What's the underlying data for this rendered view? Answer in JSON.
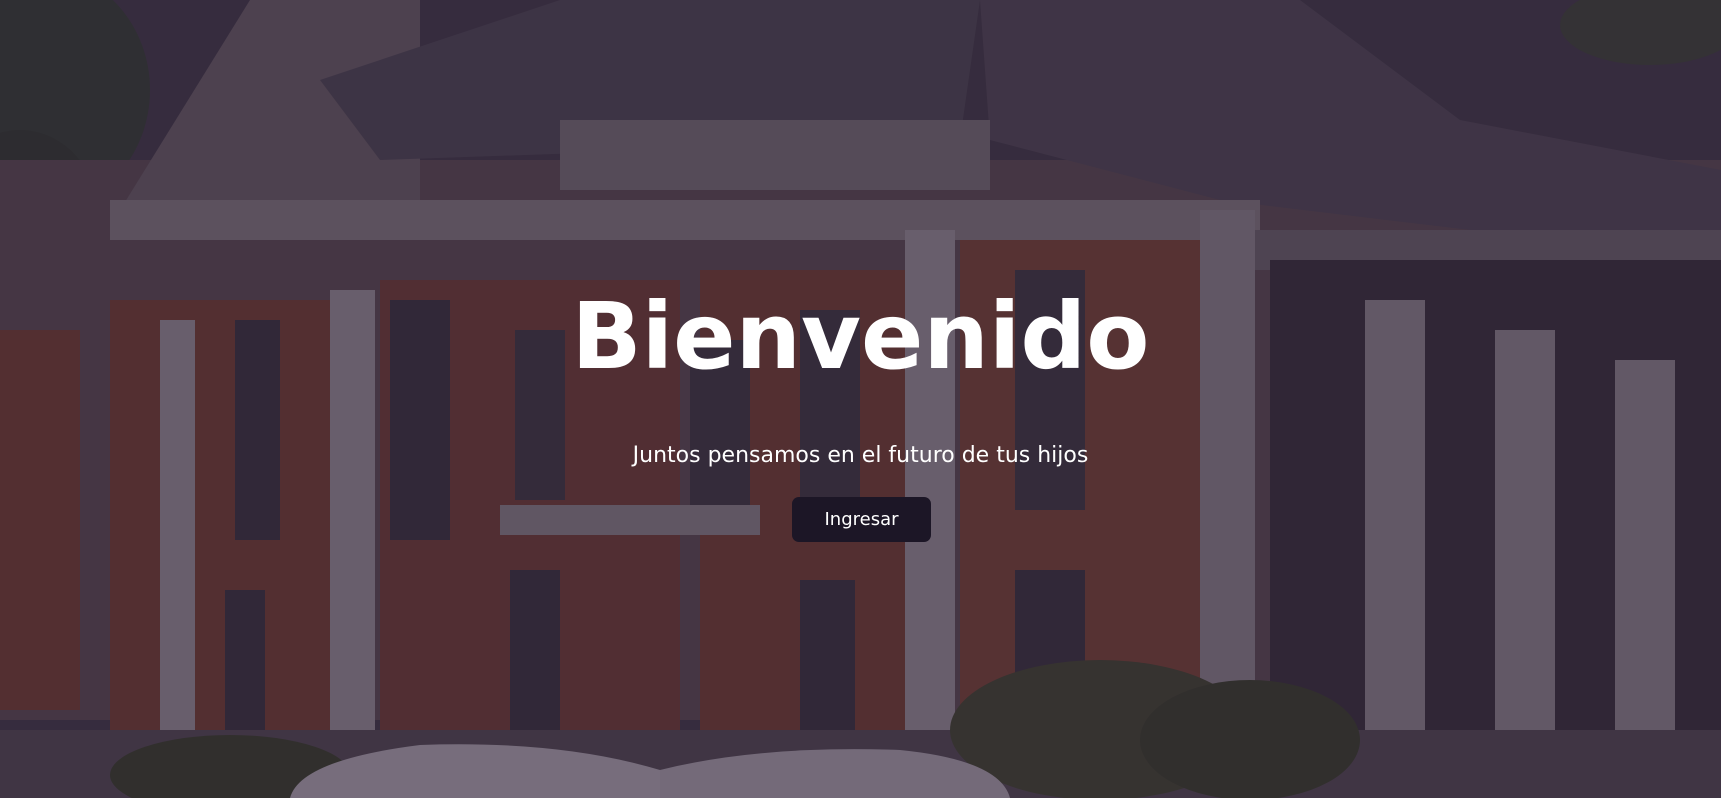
{
  "hero": {
    "title": "Bienvenido",
    "subtitle": "Juntos pensamos en el futuro de tus hijos",
    "cta_label": "Ingresar"
  },
  "colors": {
    "overlay": "#261a2e",
    "button_bg": "#1c1626",
    "text": "#ffffff",
    "brick": "#8a4a35",
    "stone": "#b9b2b8"
  }
}
